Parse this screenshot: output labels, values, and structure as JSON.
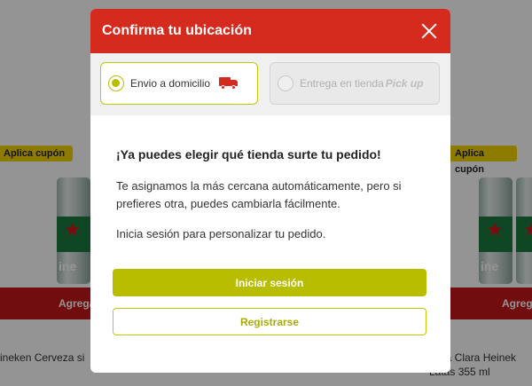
{
  "background": {
    "coupon_left": "Aplica cupón",
    "coupon_right": "Aplica cupón",
    "add_left": "Agrega",
    "add_right": "Agrega",
    "product_left": "ineken Cerveza si",
    "product_right_line1": "veza Clara Heinek",
    "product_right_line2": "Latas 355 ml",
    "can_left_text": "ine",
    "can_right_text": "ine"
  },
  "modal": {
    "title": "Confirma tu ubicación",
    "tabs": [
      {
        "label": "Envio a domicilio",
        "selected": true,
        "icon": "delivery-truck-icon"
      },
      {
        "label": "Entrega en tienda",
        "selected": false,
        "icon": "pickup-icon",
        "icon_text": "Pick up"
      }
    ],
    "heading": "¡Ya puedes elegir qué tienda surte tu pedido!",
    "paragraph1": "Te asignamos la más cercana automáticamente, pero si prefieres otra, puedes cambiarla fácilmente.",
    "paragraph2": "Inicia sesión para personalizar tu pedido.",
    "login_button": "Iniciar sesión",
    "register_button": "Registrarse"
  },
  "colors": {
    "header_red": "#d52b1e",
    "accent_olive": "#b8bd00",
    "coupon_yellow": "#f2d400",
    "add_bar_red": "#c4171b"
  }
}
